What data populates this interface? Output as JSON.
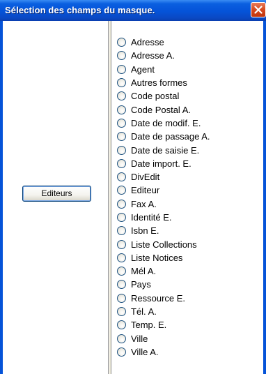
{
  "window": {
    "title": "Sélection des champs du masque."
  },
  "left_panel": {
    "button_label": "Editeurs"
  },
  "fields": [
    {
      "label": "Adresse",
      "selected": false
    },
    {
      "label": "Adresse A.",
      "selected": false
    },
    {
      "label": "Agent",
      "selected": false
    },
    {
      "label": "Autres formes",
      "selected": false
    },
    {
      "label": "Code postal",
      "selected": false
    },
    {
      "label": "Code Postal A.",
      "selected": false
    },
    {
      "label": "Date de modif. E.",
      "selected": false
    },
    {
      "label": "Date de passage A.",
      "selected": false
    },
    {
      "label": "Date de saisie E.",
      "selected": false
    },
    {
      "label": "Date import. E.",
      "selected": false
    },
    {
      "label": "DivEdit",
      "selected": false
    },
    {
      "label": "Editeur",
      "selected": false
    },
    {
      "label": "Fax A.",
      "selected": false
    },
    {
      "label": "Identité E.",
      "selected": false
    },
    {
      "label": "Isbn E.",
      "selected": false
    },
    {
      "label": "Liste Collections",
      "selected": false
    },
    {
      "label": "Liste Notices",
      "selected": false
    },
    {
      "label": "Mél A.",
      "selected": false
    },
    {
      "label": "Pays",
      "selected": false
    },
    {
      "label": "Ressource E.",
      "selected": false
    },
    {
      "label": "Tél. A.",
      "selected": false
    },
    {
      "label": "Temp. E.",
      "selected": false
    },
    {
      "label": "Ville",
      "selected": false
    },
    {
      "label": "Ville A.",
      "selected": false
    }
  ],
  "icons": {
    "close": "close-icon",
    "radio": "radio-button-icon"
  },
  "colors": {
    "titlebar": "#0553d8",
    "close_button": "#d84b20",
    "panel_background": "#ffffff",
    "radio_border": "#1c5180"
  }
}
